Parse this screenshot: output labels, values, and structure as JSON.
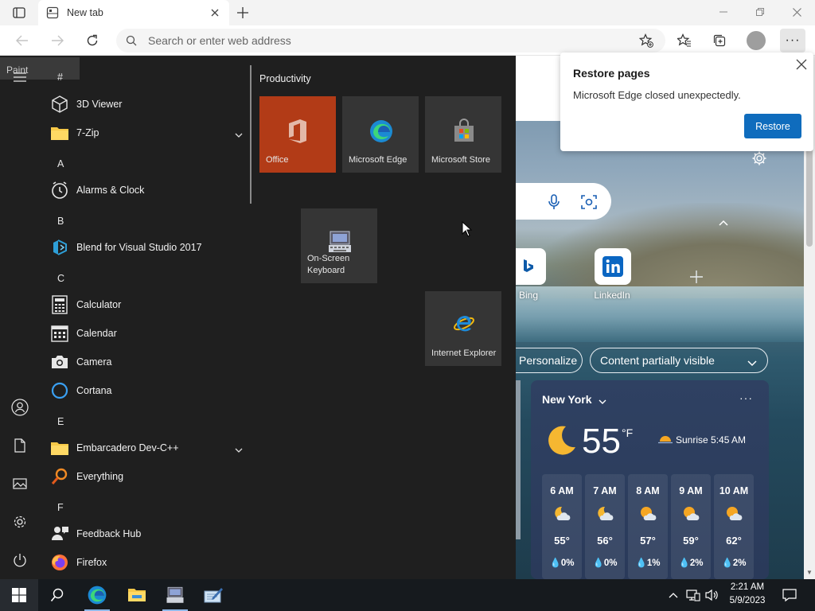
{
  "browser": {
    "tab_title": "New tab",
    "address_placeholder": "Search or enter web address"
  },
  "restore_popup": {
    "title": "Restore pages",
    "message": "Microsoft Edge closed unexpectedly.",
    "button": "Restore"
  },
  "ntp": {
    "quick_links": [
      {
        "label": "Bing",
        "icon": "bing-icon"
      },
      {
        "label": "LinkedIn",
        "icon": "linkedin-icon"
      }
    ],
    "personalize": "Personalize",
    "content_toggle": "Content partially visible"
  },
  "weather": {
    "city": "New York",
    "temperature": "55",
    "unit": "°F",
    "sunrise": "Sunrise 5:45 AM",
    "hours": [
      {
        "time": "6 AM",
        "temp": "55°",
        "precip": "0%"
      },
      {
        "time": "7 AM",
        "temp": "56°",
        "precip": "0%"
      },
      {
        "time": "8 AM",
        "temp": "57°",
        "precip": "1%"
      },
      {
        "time": "9 AM",
        "temp": "59°",
        "precip": "2%"
      },
      {
        "time": "10 AM",
        "temp": "62°",
        "precip": "2%"
      }
    ]
  },
  "start_menu": {
    "tooltip": "Paint",
    "letters": [
      "#",
      "A",
      "B",
      "C",
      "E",
      "F"
    ],
    "apps": [
      {
        "label": "3D Viewer",
        "icon": "cube-icon"
      },
      {
        "label": "7-Zip",
        "icon": "folder-icon"
      },
      {
        "label": "Alarms & Clock",
        "icon": "clock-icon"
      },
      {
        "label": "Blend for Visual Studio 2017",
        "icon": "blend-icon"
      },
      {
        "label": "Calculator",
        "icon": "calculator-icon"
      },
      {
        "label": "Calendar",
        "icon": "calendar-icon"
      },
      {
        "label": "Camera",
        "icon": "camera-icon"
      },
      {
        "label": "Cortana",
        "icon": "cortana-icon"
      },
      {
        "label": "Embarcadero Dev-C++",
        "icon": "folder-icon"
      },
      {
        "label": "Everything",
        "icon": "magnifier-icon"
      },
      {
        "label": "Feedback Hub",
        "icon": "feedback-icon"
      },
      {
        "label": "Firefox",
        "icon": "firefox-icon"
      }
    ],
    "group_title": "Productivity",
    "tiles": [
      {
        "label": "Office",
        "icon": "office-icon"
      },
      {
        "label": "Microsoft Edge",
        "icon": "edge-icon"
      },
      {
        "label": "Microsoft Store",
        "icon": "store-icon"
      },
      {
        "label": "On-Screen Keyboard",
        "icon": "keyboard-icon"
      },
      {
        "label": "Internet Explorer",
        "icon": "ie-icon"
      }
    ]
  },
  "taskbar": {
    "time": "2:21 AM",
    "date": "5/9/2023"
  },
  "colors": {
    "accent_blue": "#0f6cbd",
    "office_tile": "#b23b17",
    "start_bg": "#1f1f1f"
  }
}
